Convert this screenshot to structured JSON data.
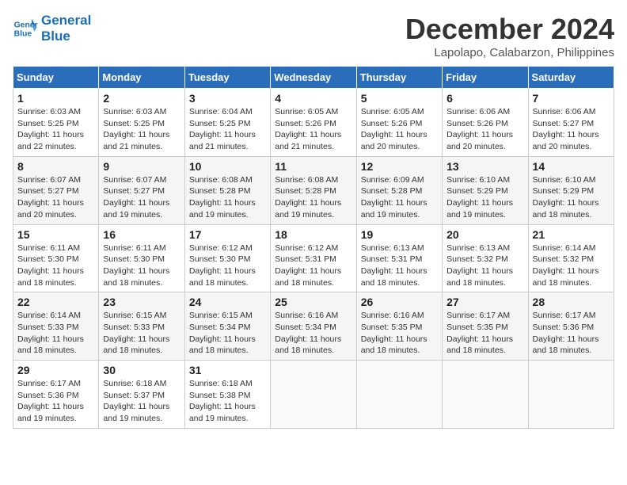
{
  "logo": {
    "line1": "General",
    "line2": "Blue"
  },
  "title": "December 2024",
  "location": "Lapolapo, Calabarzon, Philippines",
  "days_of_week": [
    "Sunday",
    "Monday",
    "Tuesday",
    "Wednesday",
    "Thursday",
    "Friday",
    "Saturday"
  ],
  "weeks": [
    [
      {
        "day": "1",
        "sunrise": "6:03 AM",
        "sunset": "5:25 PM",
        "daylight": "11 hours and 22 minutes."
      },
      {
        "day": "2",
        "sunrise": "6:03 AM",
        "sunset": "5:25 PM",
        "daylight": "11 hours and 21 minutes."
      },
      {
        "day": "3",
        "sunrise": "6:04 AM",
        "sunset": "5:25 PM",
        "daylight": "11 hours and 21 minutes."
      },
      {
        "day": "4",
        "sunrise": "6:05 AM",
        "sunset": "5:26 PM",
        "daylight": "11 hours and 21 minutes."
      },
      {
        "day": "5",
        "sunrise": "6:05 AM",
        "sunset": "5:26 PM",
        "daylight": "11 hours and 20 minutes."
      },
      {
        "day": "6",
        "sunrise": "6:06 AM",
        "sunset": "5:26 PM",
        "daylight": "11 hours and 20 minutes."
      },
      {
        "day": "7",
        "sunrise": "6:06 AM",
        "sunset": "5:27 PM",
        "daylight": "11 hours and 20 minutes."
      }
    ],
    [
      {
        "day": "8",
        "sunrise": "6:07 AM",
        "sunset": "5:27 PM",
        "daylight": "11 hours and 20 minutes."
      },
      {
        "day": "9",
        "sunrise": "6:07 AM",
        "sunset": "5:27 PM",
        "daylight": "11 hours and 19 minutes."
      },
      {
        "day": "10",
        "sunrise": "6:08 AM",
        "sunset": "5:28 PM",
        "daylight": "11 hours and 19 minutes."
      },
      {
        "day": "11",
        "sunrise": "6:08 AM",
        "sunset": "5:28 PM",
        "daylight": "11 hours and 19 minutes."
      },
      {
        "day": "12",
        "sunrise": "6:09 AM",
        "sunset": "5:28 PM",
        "daylight": "11 hours and 19 minutes."
      },
      {
        "day": "13",
        "sunrise": "6:10 AM",
        "sunset": "5:29 PM",
        "daylight": "11 hours and 19 minutes."
      },
      {
        "day": "14",
        "sunrise": "6:10 AM",
        "sunset": "5:29 PM",
        "daylight": "11 hours and 18 minutes."
      }
    ],
    [
      {
        "day": "15",
        "sunrise": "6:11 AM",
        "sunset": "5:30 PM",
        "daylight": "11 hours and 18 minutes."
      },
      {
        "day": "16",
        "sunrise": "6:11 AM",
        "sunset": "5:30 PM",
        "daylight": "11 hours and 18 minutes."
      },
      {
        "day": "17",
        "sunrise": "6:12 AM",
        "sunset": "5:30 PM",
        "daylight": "11 hours and 18 minutes."
      },
      {
        "day": "18",
        "sunrise": "6:12 AM",
        "sunset": "5:31 PM",
        "daylight": "11 hours and 18 minutes."
      },
      {
        "day": "19",
        "sunrise": "6:13 AM",
        "sunset": "5:31 PM",
        "daylight": "11 hours and 18 minutes."
      },
      {
        "day": "20",
        "sunrise": "6:13 AM",
        "sunset": "5:32 PM",
        "daylight": "11 hours and 18 minutes."
      },
      {
        "day": "21",
        "sunrise": "6:14 AM",
        "sunset": "5:32 PM",
        "daylight": "11 hours and 18 minutes."
      }
    ],
    [
      {
        "day": "22",
        "sunrise": "6:14 AM",
        "sunset": "5:33 PM",
        "daylight": "11 hours and 18 minutes."
      },
      {
        "day": "23",
        "sunrise": "6:15 AM",
        "sunset": "5:33 PM",
        "daylight": "11 hours and 18 minutes."
      },
      {
        "day": "24",
        "sunrise": "6:15 AM",
        "sunset": "5:34 PM",
        "daylight": "11 hours and 18 minutes."
      },
      {
        "day": "25",
        "sunrise": "6:16 AM",
        "sunset": "5:34 PM",
        "daylight": "11 hours and 18 minutes."
      },
      {
        "day": "26",
        "sunrise": "6:16 AM",
        "sunset": "5:35 PM",
        "daylight": "11 hours and 18 minutes."
      },
      {
        "day": "27",
        "sunrise": "6:17 AM",
        "sunset": "5:35 PM",
        "daylight": "11 hours and 18 minutes."
      },
      {
        "day": "28",
        "sunrise": "6:17 AM",
        "sunset": "5:36 PM",
        "daylight": "11 hours and 18 minutes."
      }
    ],
    [
      {
        "day": "29",
        "sunrise": "6:17 AM",
        "sunset": "5:36 PM",
        "daylight": "11 hours and 19 minutes."
      },
      {
        "day": "30",
        "sunrise": "6:18 AM",
        "sunset": "5:37 PM",
        "daylight": "11 hours and 19 minutes."
      },
      {
        "day": "31",
        "sunrise": "6:18 AM",
        "sunset": "5:38 PM",
        "daylight": "11 hours and 19 minutes."
      },
      null,
      null,
      null,
      null
    ]
  ],
  "labels": {
    "sunrise": "Sunrise:",
    "sunset": "Sunset:",
    "daylight": "Daylight:"
  }
}
